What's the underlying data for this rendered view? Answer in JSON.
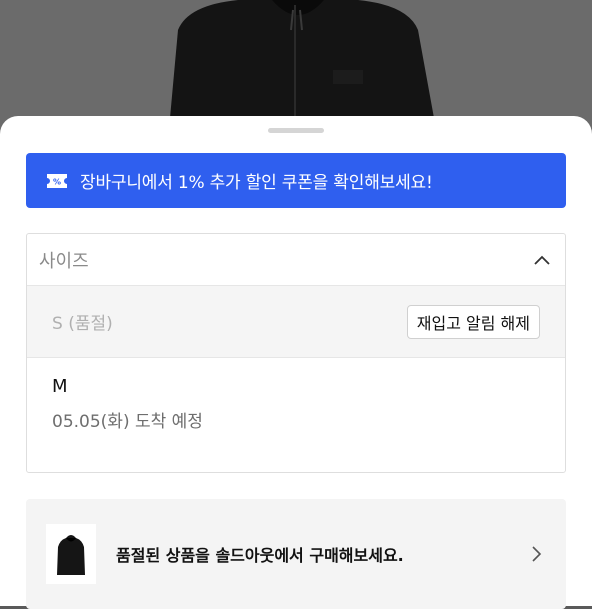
{
  "coupon_banner": {
    "text": "장바구니에서 1% 추가 할인 쿠폰을 확인해보세요!",
    "icon": "coupon-icon",
    "color": "#2f5fef"
  },
  "size_selector": {
    "label": "사이즈",
    "options": [
      {
        "label": "S (품절)",
        "status": "soldout",
        "action_label": "재입고 알림 해제"
      },
      {
        "label": "M",
        "eta": "05.05(화) 도착 예정"
      }
    ]
  },
  "soldout_banner": {
    "text": "품절된 상품을 솔드아웃에서 구매해보세요."
  }
}
